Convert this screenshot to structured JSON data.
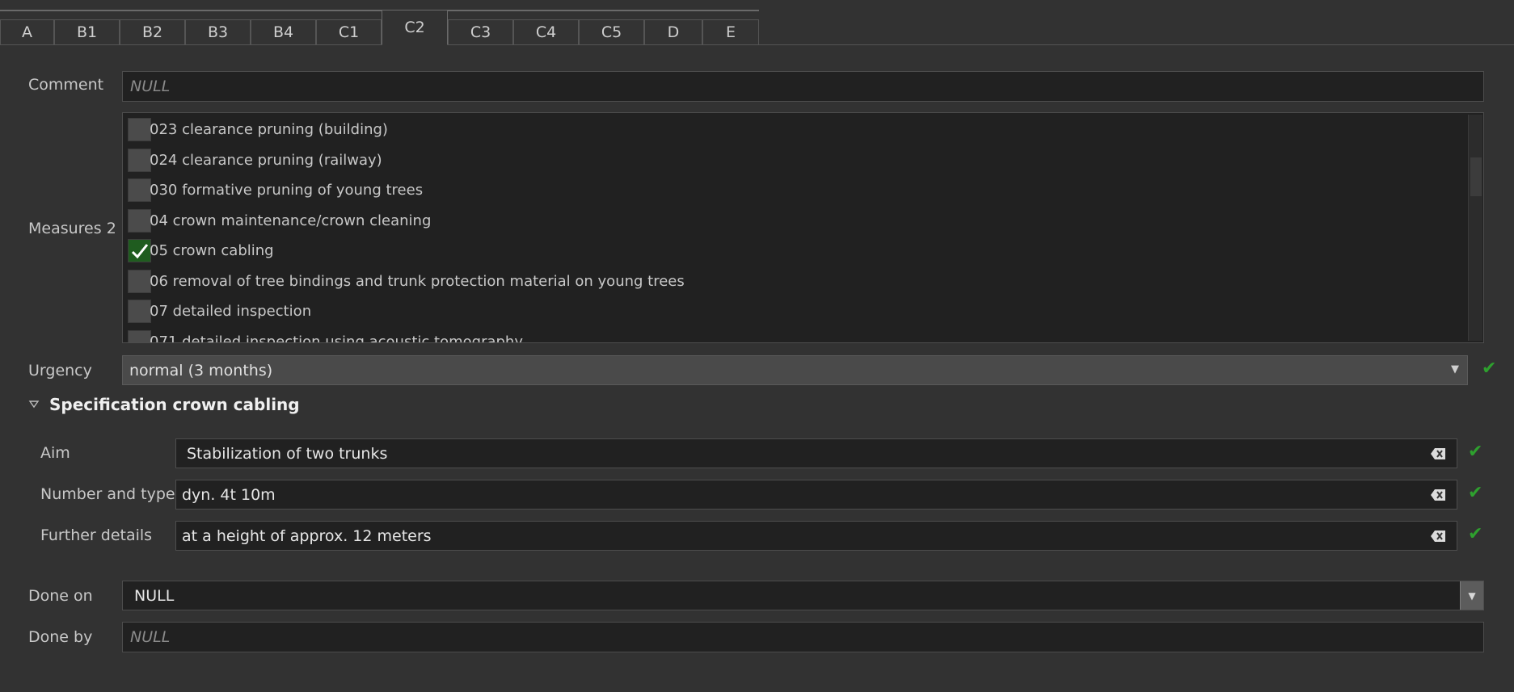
{
  "tabs": [
    {
      "label": "A"
    },
    {
      "label": "B1"
    },
    {
      "label": "B2"
    },
    {
      "label": "B3"
    },
    {
      "label": "B4"
    },
    {
      "label": "C1"
    },
    {
      "label": "C2",
      "active": true
    },
    {
      "label": "C3"
    },
    {
      "label": "C4"
    },
    {
      "label": "C5"
    },
    {
      "label": "D"
    },
    {
      "label": "E"
    }
  ],
  "comment": {
    "label": "Comment",
    "value": "NULL"
  },
  "measures": {
    "label": "Measures 2",
    "items": [
      {
        "label": "023 clearance pruning (building)",
        "checked": false
      },
      {
        "label": "024 clearance pruning (railway)",
        "checked": false
      },
      {
        "label": "030 formative pruning of young trees",
        "checked": false
      },
      {
        "label": "04 crown maintenance/crown cleaning",
        "checked": false
      },
      {
        "label": "05 crown cabling",
        "checked": true
      },
      {
        "label": "06 removal of tree bindings and trunk protection material on young trees",
        "checked": false
      },
      {
        "label": "07 detailed inspection",
        "checked": false
      },
      {
        "label": "071 detailed inspection using acoustic tomography",
        "checked": false
      }
    ]
  },
  "urgency": {
    "label": "Urgency",
    "value": "normal (3 months)"
  },
  "specification": {
    "title": "Specification crown cabling",
    "aim": {
      "label": "Aim",
      "value": "Stabilization of two trunks"
    },
    "number_type": {
      "label": "Number and type",
      "value": "dyn. 4t 10m"
    },
    "further": {
      "label": "Further details",
      "value": "at a height of approx. 12 meters"
    }
  },
  "done_on": {
    "label": "Done on",
    "value": "NULL"
  },
  "done_by": {
    "label": "Done by",
    "value": "NULL"
  },
  "colors": {
    "check": "#2ea02e",
    "checked_box": "#1f5c1f",
    "background": "#323232",
    "field": "#212121"
  }
}
